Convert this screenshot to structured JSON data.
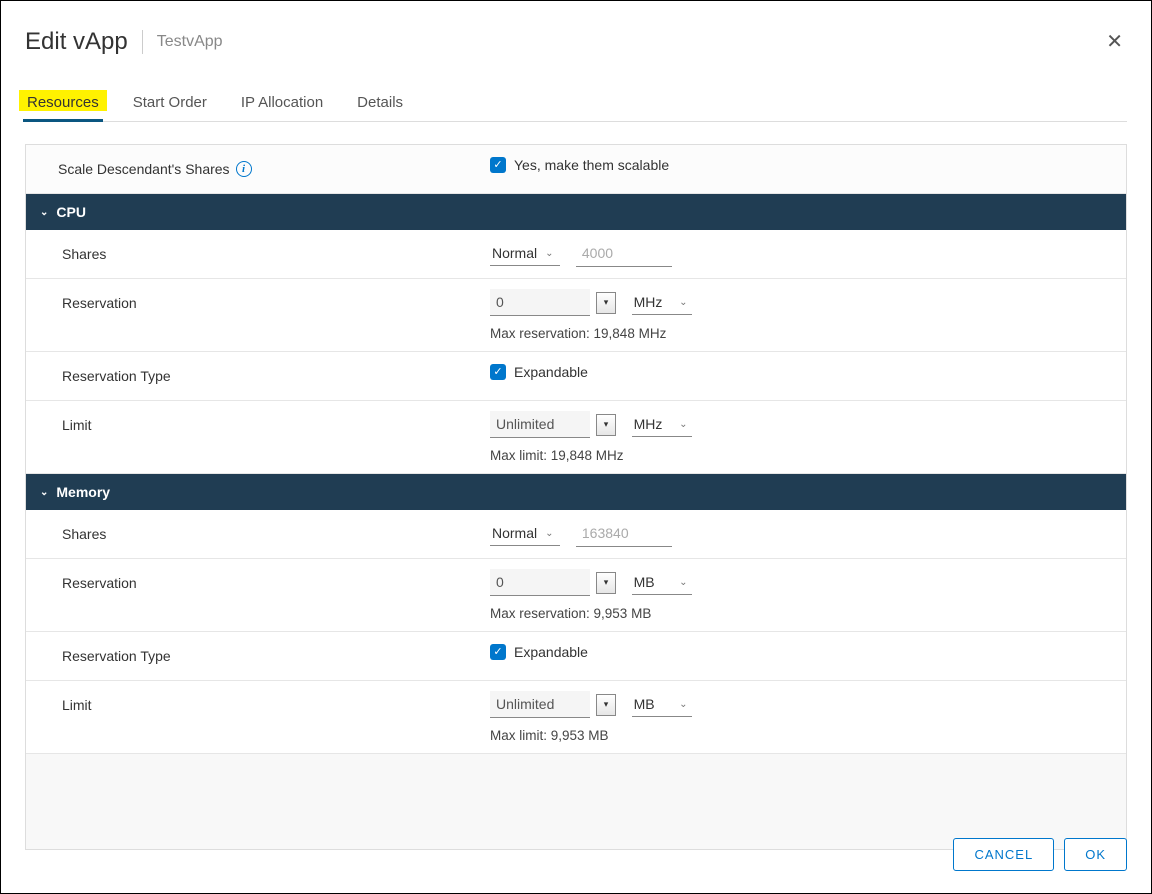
{
  "dialog": {
    "title": "Edit vApp",
    "subtitle": "TestvApp"
  },
  "tabs": {
    "resources": "Resources",
    "start_order": "Start Order",
    "ip_allocation": "IP Allocation",
    "details": "Details"
  },
  "scale": {
    "label": "Scale Descendant's Shares",
    "checkbox_label": "Yes, make them scalable"
  },
  "cpu": {
    "header": "CPU",
    "shares_label": "Shares",
    "shares_level": "Normal",
    "shares_value": "4000",
    "reservation_label": "Reservation",
    "reservation_value": "0",
    "reservation_unit": "MHz",
    "reservation_help": "Max reservation: 19,848 MHz",
    "reservation_type_label": "Reservation Type",
    "expandable_label": "Expandable",
    "limit_label": "Limit",
    "limit_value": "Unlimited",
    "limit_unit": "MHz",
    "limit_help": "Max limit: 19,848 MHz"
  },
  "memory": {
    "header": "Memory",
    "shares_label": "Shares",
    "shares_level": "Normal",
    "shares_value": "163840",
    "reservation_label": "Reservation",
    "reservation_value": "0",
    "reservation_unit": "MB",
    "reservation_help": "Max reservation: 9,953 MB",
    "reservation_type_label": "Reservation Type",
    "expandable_label": "Expandable",
    "limit_label": "Limit",
    "limit_value": "Unlimited",
    "limit_unit": "MB",
    "limit_help": "Max limit: 9,953 MB"
  },
  "footer": {
    "cancel": "CANCEL",
    "ok": "OK"
  }
}
